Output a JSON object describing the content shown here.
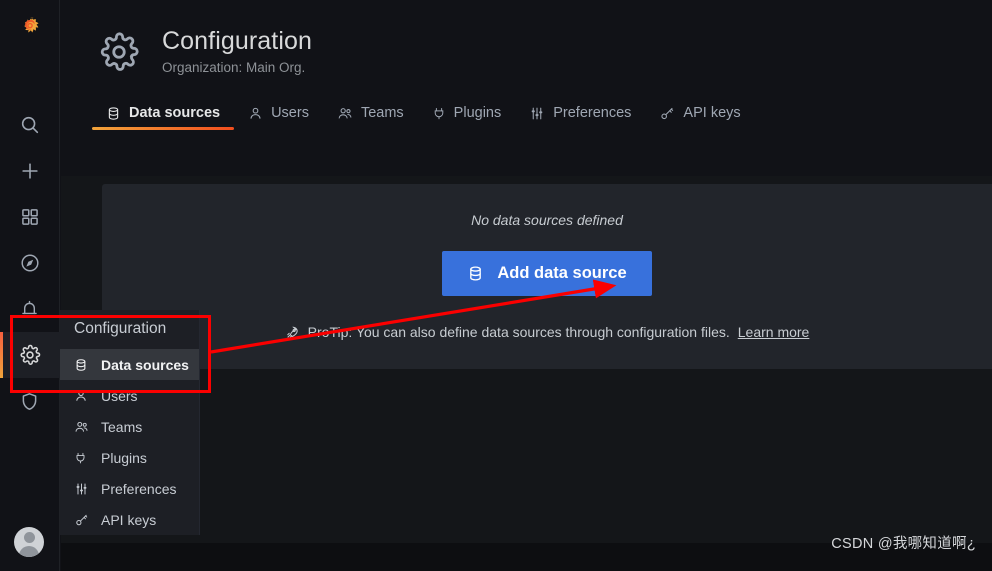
{
  "rail": {
    "logo_icon": "grafana-logo",
    "items": [
      {
        "icon": "search-icon",
        "name": "search"
      },
      {
        "icon": "plus-icon",
        "name": "create"
      },
      {
        "icon": "dashboards-icon",
        "name": "dashboards"
      },
      {
        "icon": "compass-icon",
        "name": "explore"
      },
      {
        "icon": "bell-icon",
        "name": "alerting"
      },
      {
        "icon": "gear-icon",
        "name": "configuration",
        "active": true
      },
      {
        "icon": "shield-icon",
        "name": "server-admin"
      }
    ],
    "avatar_icon": "user-avatar"
  },
  "header": {
    "icon": "gear-icon",
    "title": "Configuration",
    "subtitle": "Organization: Main Org."
  },
  "tabs": [
    {
      "label": "Data sources",
      "icon": "database-icon",
      "active": true
    },
    {
      "label": "Users",
      "icon": "user-icon",
      "active": false
    },
    {
      "label": "Teams",
      "icon": "users-icon",
      "active": false
    },
    {
      "label": "Plugins",
      "icon": "plug-icon",
      "active": false
    },
    {
      "label": "Preferences",
      "icon": "sliders-icon",
      "active": false
    },
    {
      "label": "API keys",
      "icon": "key-icon",
      "active": false
    }
  ],
  "main": {
    "empty_message": "No data sources defined",
    "add_button": {
      "label": "Add data source",
      "icon": "database-icon",
      "color": "#3871dc"
    },
    "protip": {
      "icon": "rocket-icon",
      "text": "ProTip: You can also define data sources through configuration files.",
      "link_label": "Learn more"
    }
  },
  "megamenu": {
    "title": "Configuration",
    "items": [
      {
        "label": "Data sources",
        "icon": "database-icon",
        "active": true
      },
      {
        "label": "Users",
        "icon": "user-icon",
        "active": false
      },
      {
        "label": "Teams",
        "icon": "users-icon",
        "active": false
      },
      {
        "label": "Plugins",
        "icon": "plug-icon",
        "active": false
      },
      {
        "label": "Preferences",
        "icon": "sliders-icon",
        "active": false
      },
      {
        "label": "API keys",
        "icon": "key-icon",
        "active": false
      }
    ]
  },
  "annotations": {
    "highlight_color": "#fb0000",
    "arrow_color": "#fb0000"
  },
  "watermark": "CSDN @我哪知道啊¿"
}
